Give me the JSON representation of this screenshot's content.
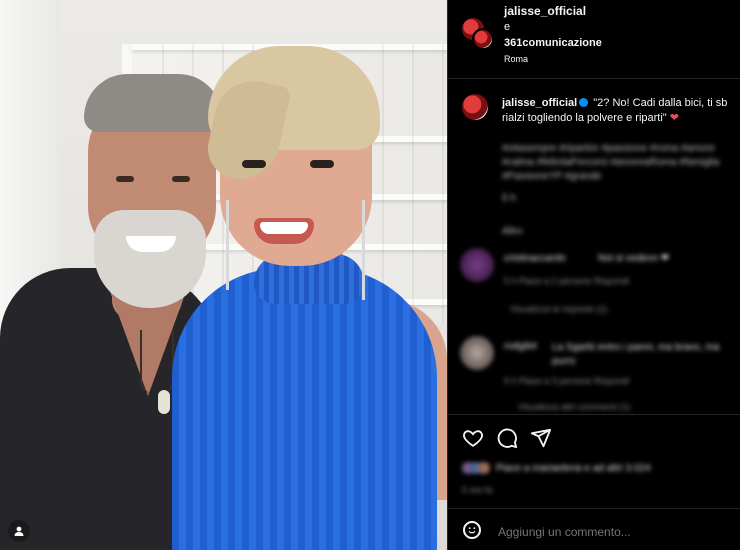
{
  "post": {
    "author": "jalisse_official",
    "conjunction": "e",
    "collaborator": "361comunicazione",
    "location": "Roma"
  },
  "caption": {
    "author": "jalisse_official",
    "text": "\"2? No! Cadi dalla bici, ti sb rialzi togliendo la polvere e riparti\"",
    "emoji": "❤"
  },
  "hidden": {
    "hashtags": "#vitasempre #ripartire #passione #roma #amore #calma #felicitaPercorsi #amoreaRoma #famiglia #PassioneYP #grande",
    "time": "5 h",
    "more": "Altro"
  },
  "comments": [
    {
      "user": "cristinaccardo",
      "text": "Noi si vedevo ❤",
      "meta": "5 h   Piace a 2 persone   Rispondi",
      "replies": "Visualizza le risposte (1)"
    },
    {
      "user": "rodgilet",
      "text": "La Sgarbi entro i panni, ma bravo, ma purro",
      "meta": "5 h   Piace a 3 persone   Rispondi",
      "replies": "Visualizza altri commenti (1)"
    }
  ],
  "likes": {
    "text": "Piace a mariaelena e ad altri 3.024",
    "age": "5 ore fa"
  },
  "comment_box": {
    "placeholder": "Aggiungi un commento..."
  },
  "icons": {
    "like": "heart-outline-icon",
    "comment": "comment-bubble-icon",
    "share": "paper-plane-icon",
    "emoji": "emoji-smile-icon",
    "tag": "user-tag-icon"
  },
  "colors": {
    "background": "#000000",
    "text": "#f5f5f5",
    "muted": "#a8a8a8",
    "verified": "#0095f6",
    "heart": "#ed4956"
  }
}
